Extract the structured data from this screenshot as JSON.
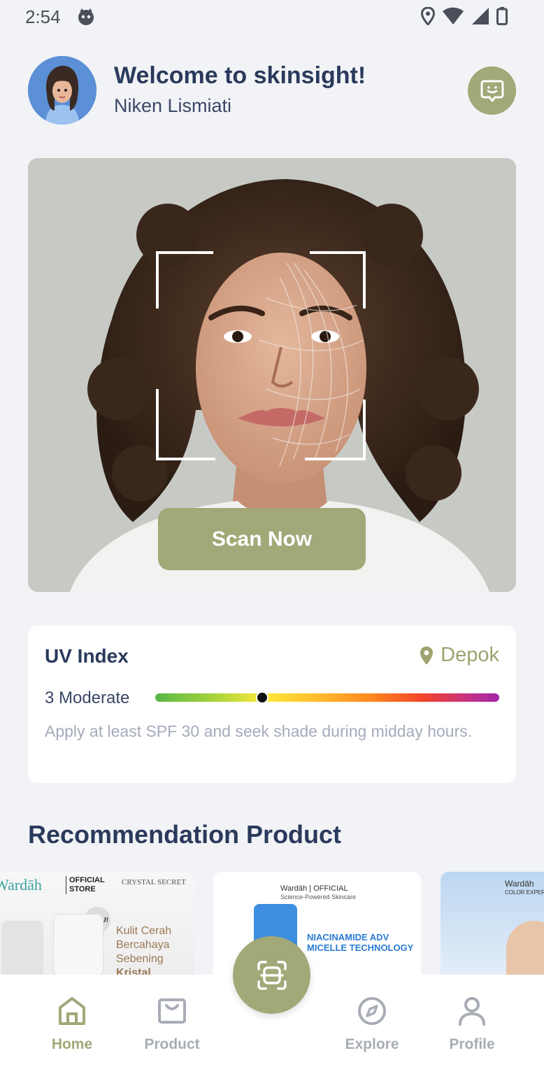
{
  "status_bar": {
    "time": "2:54"
  },
  "header": {
    "welcome": "Welcome to skinsight!",
    "user_name": "Niken Lismiati"
  },
  "hero": {
    "scan_label": "Scan Now"
  },
  "uv": {
    "title": "UV Index",
    "location": "Depok",
    "level_text": "3 Moderate",
    "level_fraction": 0.31,
    "advice": "Apply at least SPF 30 and seek shade during midday hours."
  },
  "recommendation": {
    "title": "Recommendation Product",
    "products": [
      {
        "brand": "Wardāh",
        "badge": "OFFICIAL STORE",
        "line": "CRYSTAL SECRET",
        "tag": "BARU!",
        "copy_1": "Kulit Cerah",
        "copy_2": "Bercahaya",
        "copy_3": "Sebening",
        "copy_4": "Kristal"
      },
      {
        "brand": "Wardāh | OFFICIAL",
        "sub": "Science-Powered Skincare",
        "headline_1": "NIACINAMIDE ADV",
        "headline_2": "MICELLE TECHNOLOGY"
      },
      {
        "brand": "Wardāh",
        "sub": "COLOR EXPERT"
      }
    ]
  },
  "nav": {
    "home": "Home",
    "product": "Product",
    "explore": "Explore",
    "profile": "Profile"
  },
  "colors": {
    "accent": "#a2a878",
    "text_dark": "#2a3a5c",
    "muted": "#a8acb5"
  },
  "icons": [
    "face-cat-icon",
    "location-icon",
    "wifi-icon",
    "signal-icon",
    "battery-icon",
    "chat-icon",
    "pin-icon",
    "scan-icon",
    "home-icon",
    "bag-icon",
    "compass-icon",
    "person-icon"
  ]
}
